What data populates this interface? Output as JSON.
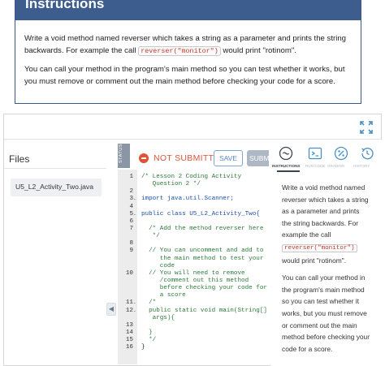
{
  "instructions": {
    "title": "Instructions",
    "para1_a": "Write a void method named reverser which takes a string as a parameter and prints the string backwards. For example the call ",
    "para1_code": "reverser(\"monitor\")",
    "para1_b": " would print \"rotinom\".",
    "para2": "You can call your method in the program's main method so you can test whether it works, but you must remove or comment out the main method before checking your code for a score."
  },
  "files": {
    "title": "Files",
    "items": [
      "U5_L2_Activity_Two.java"
    ]
  },
  "toolbar": {
    "status_tab": "STATUS",
    "status_label": "NOT SUBMITTED",
    "save_label": "SAVE",
    "submit_label": "SUBM"
  },
  "code": [
    {
      "n": "1",
      "fold": "",
      "text": "/* Lesson 2 Coding Activity",
      "type": "comment"
    },
    {
      "n": "",
      "fold": "",
      "text": "   Question 2 */",
      "type": "comment"
    },
    {
      "n": "2",
      "fold": "",
      "text": "",
      "type": "plain"
    },
    {
      "n": "3",
      "fold": "-",
      "text": "import java.util.Scanner;",
      "type": "keyword"
    },
    {
      "n": "4",
      "fold": "",
      "text": "",
      "type": "plain"
    },
    {
      "n": "5",
      "fold": "-",
      "text": "public class U5_L2_Activity_Two{",
      "type": "keyword"
    },
    {
      "n": "6",
      "fold": "",
      "text": "",
      "type": "plain"
    },
    {
      "n": "7",
      "fold": "",
      "text": "  /* Add the method reverser here",
      "type": "comment"
    },
    {
      "n": "",
      "fold": "",
      "text": "   */",
      "type": "comment"
    },
    {
      "n": "8",
      "fold": "",
      "text": "",
      "type": "plain"
    },
    {
      "n": "9",
      "fold": "",
      "text": "  // You can uncomment and add to",
      "type": "comment"
    },
    {
      "n": "",
      "fold": "",
      "text": "     the main method to test your",
      "type": "comment"
    },
    {
      "n": "",
      "fold": "",
      "text": "     code",
      "type": "comment"
    },
    {
      "n": "10",
      "fold": "",
      "text": "  // You will need to remove",
      "type": "comment"
    },
    {
      "n": "",
      "fold": "",
      "text": "     /comment out this method",
      "type": "comment"
    },
    {
      "n": "",
      "fold": "",
      "text": "     before checking your code for",
      "type": "comment"
    },
    {
      "n": "",
      "fold": "",
      "text": "     a score",
      "type": "comment"
    },
    {
      "n": "11",
      "fold": "-",
      "text": "  /*",
      "type": "comment"
    },
    {
      "n": "12",
      "fold": "-",
      "text": "  public static void main(String[]",
      "type": "comment"
    },
    {
      "n": "",
      "fold": "",
      "text": "   args){",
      "type": "comment"
    },
    {
      "n": "13",
      "fold": "",
      "text": "",
      "type": "plain"
    },
    {
      "n": "14",
      "fold": "",
      "text": "  }",
      "type": "comment"
    },
    {
      "n": "15",
      "fold": "",
      "text": "  */",
      "type": "comment"
    },
    {
      "n": "16",
      "fold": "",
      "text": "}",
      "type": "plain"
    }
  ],
  "right_panel": {
    "tabs": [
      "INSTRUCTIONS",
      "RUN CODE",
      "GRADING",
      "HISTORY"
    ],
    "icons": [
      "question-circle-icon",
      "terminal-icon",
      "gauge-icon",
      "history-icon"
    ],
    "para1_a": "Write a void method named reverser which takes a string as a parameter and prints the string backwards. For example the call ",
    "para1_code": "reverser(\"monitor\")",
    "para1_b": " would print \"rotinom\".",
    "para2": "You can call your method in the program's main method so you can test whether it works, but you must remove or comment out the main method before checking your code for a score."
  },
  "colors": {
    "header_blue": "#3d5d8f",
    "not_submitted_red": "#e05234",
    "comment_green": "#2b7a3a",
    "keyword_blue": "#1a4fa8",
    "save_blue": "#5b86c2"
  }
}
